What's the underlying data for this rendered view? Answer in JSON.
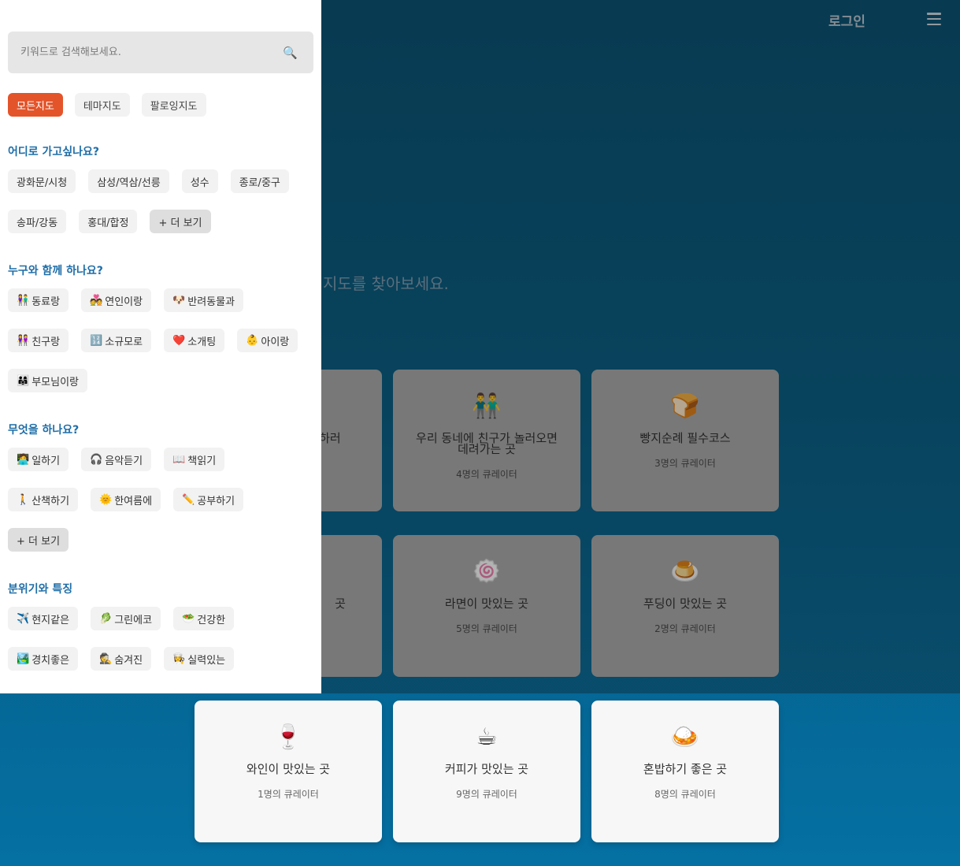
{
  "header": {
    "login_label": "로그인"
  },
  "hero": {
    "text_visible": "지도를 찾아보세요."
  },
  "cards": [
    {
      "icon": "",
      "title": "업하러",
      "curators": ""
    },
    {
      "icon": "👬",
      "title": "우리 동네에 친구가 놀러오면 데려가는 곳",
      "curators": "4명의 큐레이터"
    },
    {
      "icon": "🍞",
      "title": "빵지순례 필수코스",
      "curators": "3명의 큐레이터"
    },
    {
      "icon": "",
      "title": "곳",
      "curators": ""
    },
    {
      "icon": "🍥",
      "title": "라면이 맛있는 곳",
      "curators": "5명의 큐레이터"
    },
    {
      "icon": "🍮",
      "title": "푸딩이 맛있는 곳",
      "curators": "2명의 큐레이터"
    },
    {
      "icon": "🍷",
      "title": "와인이 맛있는 곳",
      "curators": "1명의 큐레이터"
    },
    {
      "icon": "☕",
      "title": "커피가 맛있는 곳",
      "curators": "9명의 큐레이터"
    },
    {
      "icon": "🍛",
      "title": "혼밥하기 좋은 곳",
      "curators": "8명의 큐레이터"
    }
  ],
  "sidebar": {
    "search": {
      "placeholder": "키워드로 검색해보세요."
    },
    "tabs": [
      "모든지도",
      "테마지도",
      "팔로잉지도"
    ],
    "sections": {
      "where": {
        "title": "어디로 가고싶나요?",
        "chips": [
          "광화문/시청",
          "삼성/역삼/선릉",
          "성수",
          "종로/중구",
          "송파/강동",
          "홍대/합정"
        ],
        "more": "+ 더 보기"
      },
      "who": {
        "title": "누구와 함께 하나요?",
        "chips": [
          {
            "icon": "👫",
            "label": "동료랑"
          },
          {
            "icon": "💑",
            "label": "연인이랑"
          },
          {
            "icon": "🐶",
            "label": "반려동물과"
          },
          {
            "icon": "👭",
            "label": "친구랑"
          },
          {
            "icon": "🔢",
            "label": "소규모로"
          },
          {
            "icon": "❤️",
            "label": "소개팅"
          },
          {
            "icon": "👶",
            "label": "아이랑"
          },
          {
            "icon": "👨‍👩‍👧",
            "label": "부모님이랑"
          }
        ]
      },
      "what": {
        "title": "무엇을 하나요?",
        "chips": [
          {
            "icon": "🧑‍💻",
            "label": "일하기"
          },
          {
            "icon": "🎧",
            "label": "음악듣기"
          },
          {
            "icon": "📖",
            "label": "책읽기"
          },
          {
            "icon": "🚶",
            "label": "산책하기"
          },
          {
            "icon": "🌞",
            "label": "한여름에"
          },
          {
            "icon": "✏️",
            "label": "공부하기"
          }
        ],
        "more": "+ 더 보기"
      },
      "mood": {
        "title": "분위기와 특징",
        "chips": [
          {
            "icon": "✈️",
            "label": "현지같은"
          },
          {
            "icon": "🥬",
            "label": "그린에코"
          },
          {
            "icon": "🥗",
            "label": "건강한"
          },
          {
            "icon": "🏞️",
            "label": "경치좋은"
          },
          {
            "icon": "🕵️",
            "label": "숨겨진"
          },
          {
            "icon": "👩‍🍳",
            "label": "실력있는"
          }
        ]
      }
    }
  }
}
